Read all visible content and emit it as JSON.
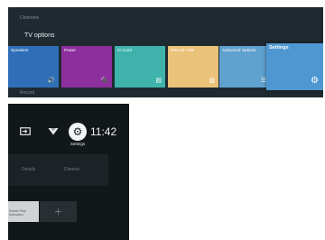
{
  "top_panel": {
    "channels_label": "Channels",
    "section_title": "TV options",
    "record_label": "Record",
    "tiles": [
      {
        "label": "Speakers",
        "icon": "speaker-icon",
        "glyph": "🔊",
        "color": "#2f6fb7"
      },
      {
        "label": "Power",
        "icon": "power-plug-icon",
        "glyph": "🔌",
        "color": "#8e2f9e"
      },
      {
        "label": "CI Card",
        "icon": "card-icon",
        "glyph": "▤",
        "color": "#3fb3ab"
      },
      {
        "label": "Manual USB",
        "icon": "manual-book-icon",
        "glyph": "▥",
        "color": "#ebc27a"
      },
      {
        "label": "Advanced Options",
        "icon": "list-icon",
        "glyph": "☰",
        "color": "#5fa1cf"
      },
      {
        "label": "Settings",
        "icon": "gear-icon",
        "glyph": "⚙",
        "color": "#4f97d1",
        "focused": true
      }
    ]
  },
  "bottom_panel": {
    "status_bar": {
      "input_icon": "input-source-icon",
      "wifi_icon": "wifi-icon",
      "settings_icon": "gear-icon",
      "settings_tooltip": "Settings",
      "time": "11:42"
    },
    "buttons": {
      "details": "Details",
      "dismiss": "Dismiss"
    },
    "app_thumb_label": "Screen Play Instruction",
    "add_glyph": "+"
  },
  "colors": {
    "panel_top_bg": "#1f2a30",
    "panel_bottom_bg": "#12171a",
    "focused_tile": "#4f97d1"
  }
}
